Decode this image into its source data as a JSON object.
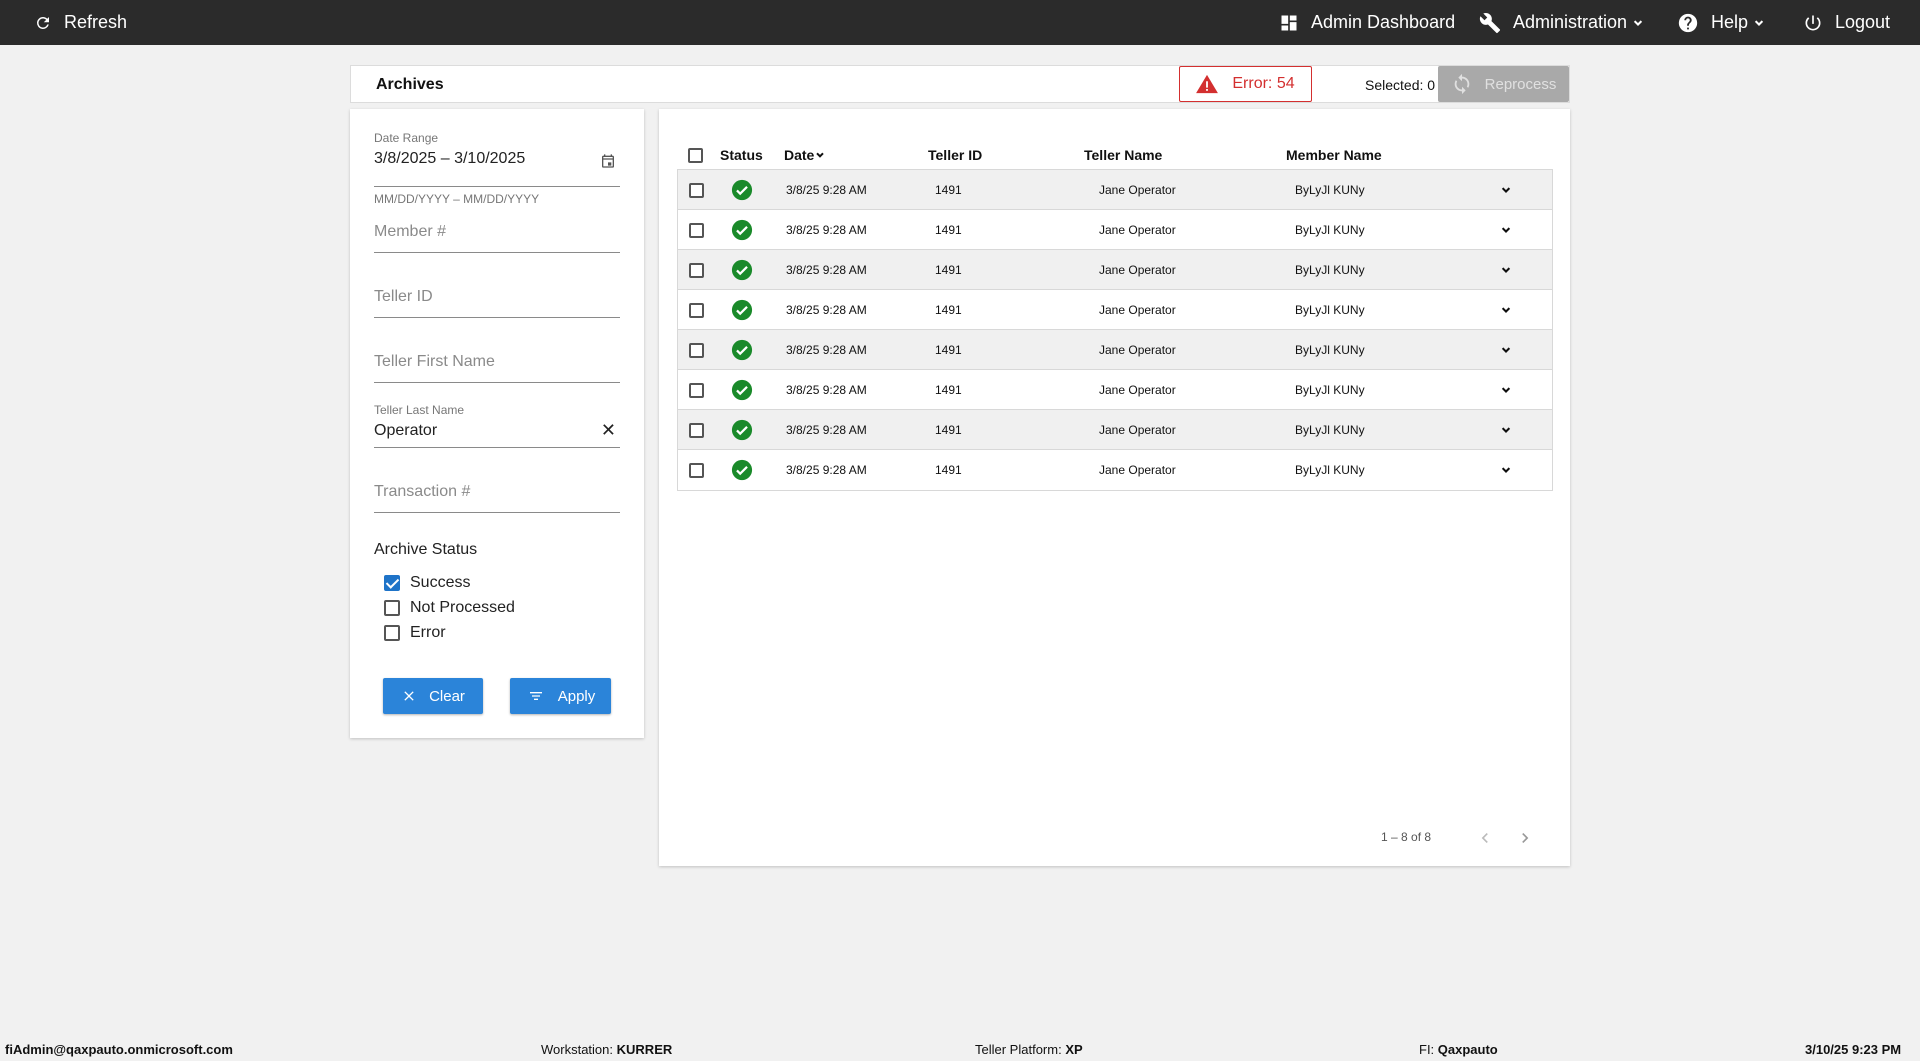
{
  "topbar": {
    "refresh": "Refresh",
    "admin_dashboard": "Admin Dashboard",
    "administration": "Administration",
    "help": "Help",
    "logout": "Logout"
  },
  "header": {
    "title": "Archives",
    "error_badge": "Error: 54",
    "selected": "Selected: 0",
    "reprocess": "Reprocess"
  },
  "filters": {
    "date_range_label": "Date Range",
    "date_range_value": "3/8/2025 – 3/10/2025",
    "date_hint": "MM/DD/YYYY – MM/DD/YYYY",
    "member_placeholder": "Member #",
    "teller_id_placeholder": "Teller ID",
    "teller_first_placeholder": "Teller First Name",
    "teller_last_label": "Teller Last Name",
    "teller_last_value": "Operator",
    "transaction_placeholder": "Transaction #",
    "archive_status_title": "Archive Status",
    "statuses": [
      {
        "label": "Success",
        "checked": true
      },
      {
        "label": "Not Processed",
        "checked": false
      },
      {
        "label": "Error",
        "checked": false
      }
    ],
    "clear_button": "Clear",
    "apply_button": "Apply"
  },
  "table": {
    "columns": [
      "Status",
      "Date",
      "Teller ID",
      "Teller Name",
      "Member Name"
    ],
    "rows": [
      {
        "date": "3/8/25 9:28 AM",
        "teller_id": "1491",
        "teller_name": "Jane Operator",
        "member_name": "ByLyJl KUNy"
      },
      {
        "date": "3/8/25 9:28 AM",
        "teller_id": "1491",
        "teller_name": "Jane Operator",
        "member_name": "ByLyJl KUNy"
      },
      {
        "date": "3/8/25 9:28 AM",
        "teller_id": "1491",
        "teller_name": "Jane Operator",
        "member_name": "ByLyJl KUNy"
      },
      {
        "date": "3/8/25 9:28 AM",
        "teller_id": "1491",
        "teller_name": "Jane Operator",
        "member_name": "ByLyJl KUNy"
      },
      {
        "date": "3/8/25 9:28 AM",
        "teller_id": "1491",
        "teller_name": "Jane Operator",
        "member_name": "ByLyJl KUNy"
      },
      {
        "date": "3/8/25 9:28 AM",
        "teller_id": "1491",
        "teller_name": "Jane Operator",
        "member_name": "ByLyJl KUNy"
      },
      {
        "date": "3/8/25 9:28 AM",
        "teller_id": "1491",
        "teller_name": "Jane Operator",
        "member_name": "ByLyJl KUNy"
      },
      {
        "date": "3/8/25 9:28 AM",
        "teller_id": "1491",
        "teller_name": "Jane Operator",
        "member_name": "ByLyJl KUNy"
      }
    ],
    "pager_text": "1 – 8 of 8"
  },
  "footer": {
    "user": "fiAdmin@qaxpauto.onmicrosoft.com",
    "workstation_label": "Workstation:",
    "workstation_value": "KURRER",
    "platform_label": "Teller Platform:",
    "platform_value": "XP",
    "fi_label": "FI:",
    "fi_value": "Qaxpauto",
    "datetime": "3/10/25 9:23 PM"
  },
  "colors": {
    "topbar": "#2b2b2b",
    "accent": "#2b84d9",
    "error": "#d32f2f",
    "success": "#1a8a2a"
  }
}
